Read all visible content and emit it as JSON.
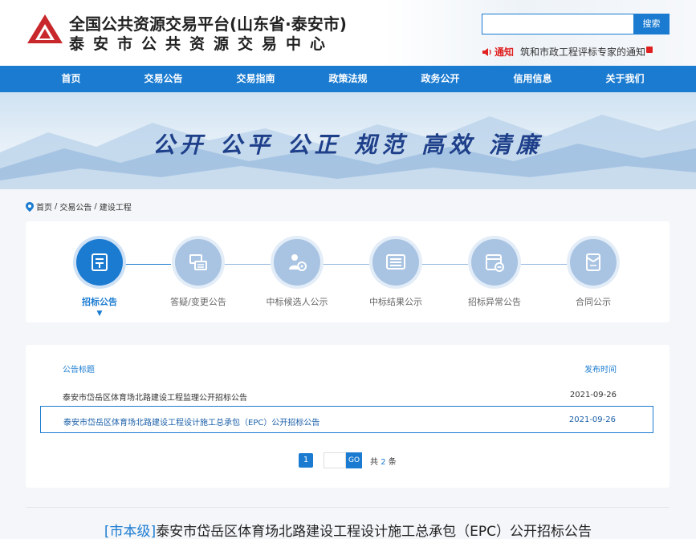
{
  "header": {
    "title_line1": "全国公共资源交易平台(山东省·泰安市)",
    "title_line2": "泰安市公共资源交易中心",
    "search": {
      "placeholder": "",
      "button_label": "搜索"
    },
    "notice": {
      "tag": "通知",
      "text": "筑和市政工程评标专家的通知"
    }
  },
  "nav": {
    "items": [
      "首页",
      "交易公告",
      "交易指南",
      "政策法规",
      "政务公开",
      "信用信息",
      "关于我们"
    ]
  },
  "banner": {
    "slogan": "公开 公平 公正 规范 高效 清廉"
  },
  "breadcrumb": {
    "items": [
      "首页",
      "/",
      "交易公告",
      "/",
      "建设工程"
    ]
  },
  "steps": {
    "items": [
      {
        "label": "招标公告",
        "icon": "document-icon",
        "active": true
      },
      {
        "label": "答疑/变更公告",
        "icon": "exchange-icon",
        "active": false
      },
      {
        "label": "中标候选人公示",
        "icon": "person-icon",
        "active": false
      },
      {
        "label": "中标结果公示",
        "icon": "list-icon",
        "active": false
      },
      {
        "label": "招标异常公告",
        "icon": "calendar-minus-icon",
        "active": false
      },
      {
        "label": "合同公示",
        "icon": "contract-icon",
        "active": false
      }
    ],
    "active_arrow": "▼"
  },
  "list": {
    "header": {
      "title": "公告标题",
      "date": "发布时间"
    },
    "rows": [
      {
        "title": "泰安市岱岳区体育场北路建设工程监理公开招标公告",
        "date": "2021-09-26"
      },
      {
        "title": "泰安市岱岳区体育场北路建设工程设计施工总承包（EPC）公开招标公告",
        "date": "2021-09-26"
      }
    ]
  },
  "pagination": {
    "current": "1",
    "go_label": "GO",
    "total_prefix": "共",
    "total": "2",
    "total_suffix": "条"
  },
  "detail": {
    "level": "[市本级]",
    "title": "泰安市岱岳区体育场北路建设工程设计施工总承包（EPC）公开招标公告"
  },
  "colors": {
    "primary": "#1a7bd1",
    "notice_red": "#e02020",
    "slogan": "#1e3f8a"
  }
}
